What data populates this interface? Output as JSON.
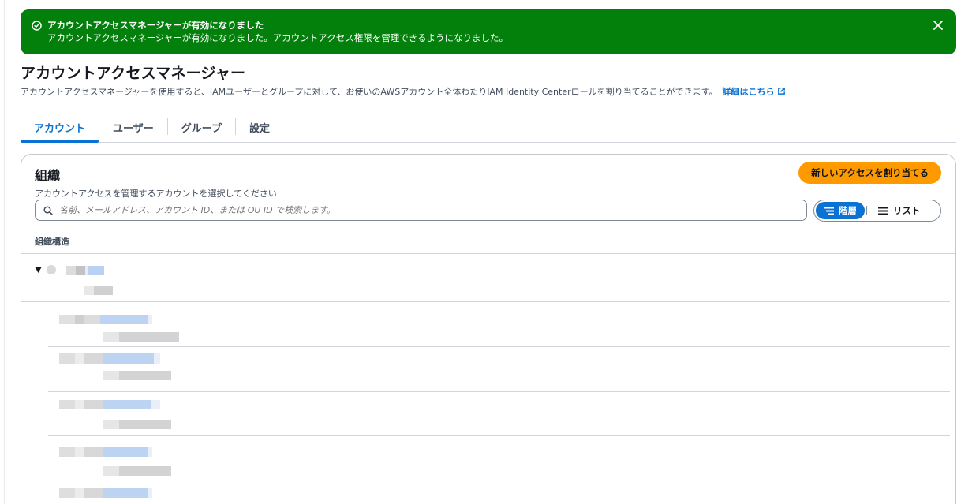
{
  "flash": {
    "title": "アカウントアクセスマネージャーが有効になりました",
    "message": "アカウントアクセスマネージャーが有効になりました。アカウントアクセス権限を管理できるようになりました。",
    "color": "#037f0c",
    "icon": "success-check-icon",
    "close_icon": "close-icon"
  },
  "header": {
    "title": "アカウントアクセスマネージャー",
    "description": "アカウントアクセスマネージャーを使用すると、IAMユーザーとグループに対して、お使いのAWSアカウント全体わたりIAM Identity Centerロールを割り当てることができます。",
    "learn_more": "詳細はこちら",
    "link_color": "#0972d3"
  },
  "tabs": [
    {
      "label": "アカウント",
      "active": true
    },
    {
      "label": "ユーザー",
      "active": false
    },
    {
      "label": "グループ",
      "active": false
    },
    {
      "label": "設定",
      "active": false
    }
  ],
  "organization": {
    "title": "組織",
    "subtitle": "アカウントアクセスを管理するアカウントを選択してください",
    "assign_button": "新しいアクセスを割り当てる",
    "assign_color": "#ff9900",
    "search_placeholder": "名前、メールアドレス、アカウント ID、または OU ID で検索します。",
    "view_toggle": {
      "hierarchy": "階層",
      "list": "リスト",
      "selected": "hierarchy"
    },
    "structure_label": "組織構造"
  }
}
